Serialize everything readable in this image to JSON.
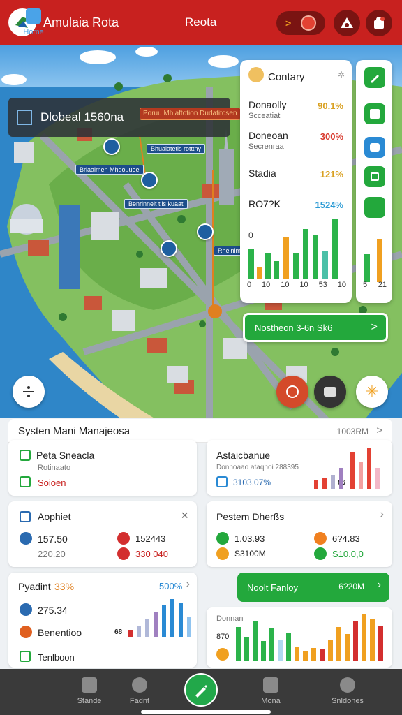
{
  "topbar": {
    "app_title": "Amulaia Rota",
    "page_title": "Reota",
    "pill_label": ">"
  },
  "map": {
    "label_main": "Dlobeal 1560na",
    "label_sub": "Poruu Mhlaftotion Dudatitosen",
    "tags": [
      "Brlaalmen Mhdouuee",
      "Bhuaiatetis rottthy",
      "Benrinneit tlls kuaat",
      "Rhelnimanbntoh"
    ],
    "stats": {
      "title": "Contary",
      "rows": [
        {
          "name": "Donaolly",
          "sub": "Scceatiat",
          "value": "90.1%",
          "color": "#d9a020"
        },
        {
          "name": "Doneoan",
          "sub": "Secrenraa",
          "value": "300%",
          "color": "#d83a2e"
        },
        {
          "name": "Stadia",
          "sub": "",
          "value": "121%",
          "color": "#d9a020"
        },
        {
          "name": "RO7?K",
          "sub": "",
          "value": "1524%",
          "color": "#2a9ad4"
        }
      ],
      "axis_top": "0",
      "axis": [
        "0",
        "10",
        "10",
        "10",
        "53",
        "10"
      ],
      "side_axis": [
        "5",
        "21"
      ]
    },
    "green_button": "Nostheon  3-6n Sk6",
    "green_button_chevron": ">"
  },
  "panel": {
    "title": "Systen Mani Manajeosa",
    "meta": "1003RM",
    "chev": ">",
    "card1": {
      "title": "Peta Sneacla",
      "sub": "Rotinaato",
      "value": "Soioen"
    },
    "card2": {
      "title": "Astaicbanue",
      "sub": "Donnoaao ataqnoi 288395",
      "value": "3103.07%",
      "label": "86"
    },
    "card3": {
      "title": "Aophiet",
      "close": "×",
      "a_val": "157.50",
      "a_sub": "220.20",
      "b_val": "152443",
      "b_sub": "330 040"
    },
    "card4": {
      "title": "Pestem Dherßs",
      "a_val": "1.03.93",
      "a_sub": "S3100M",
      "b_val": "6?4.83",
      "b_sub": "S10.0,0"
    },
    "card5": {
      "title": "Pyadint",
      "title_pct": "33%",
      "pct": "500%",
      "val1": "275.34",
      "val2": "Benentioo",
      "val3": "Tenlboon",
      "label": "68"
    },
    "card6": {
      "button": "Noolt Fanloy",
      "button_val": "6?20M",
      "sub": "Donnan",
      "val": "870"
    }
  },
  "nav": {
    "items": [
      "Home",
      "Stande",
      "Fadnt",
      "Mona",
      "Snldones"
    ]
  }
}
